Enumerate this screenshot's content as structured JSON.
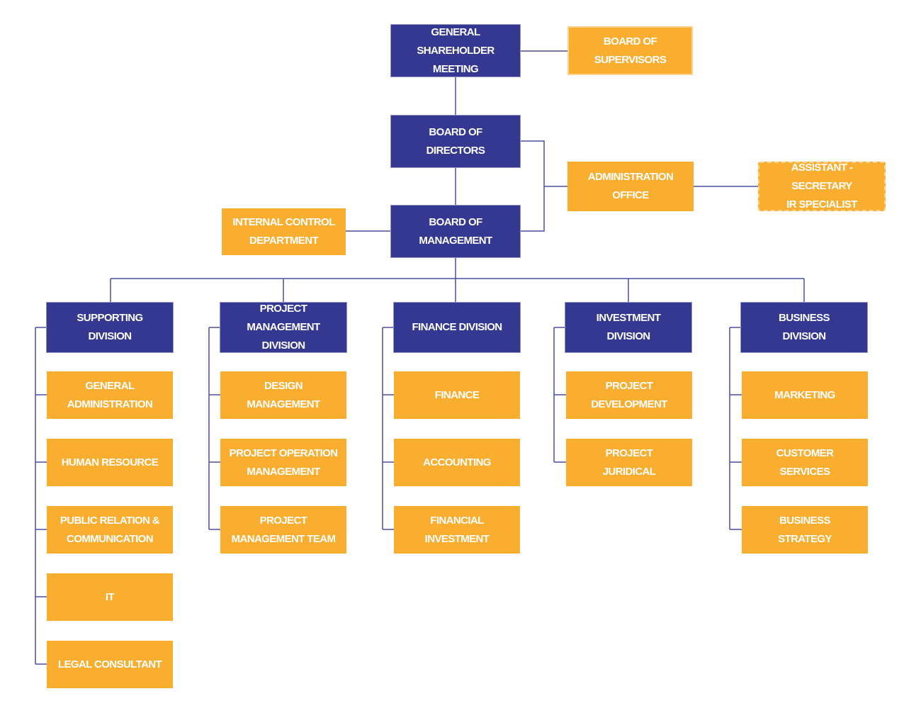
{
  "colors": {
    "primary": "#353891",
    "secondary": "#f9ae30",
    "connector": "#4b4da2"
  },
  "top": {
    "general_shareholder_meeting": "GENERAL\nSHAREHOLDER MEETING",
    "board_of_supervisors": "BOARD OF\nSUPERVISORS",
    "board_of_directors": "BOARD OF\nDIRECTORS",
    "administration_office": "ADMINISTRATION\nOFFICE",
    "assistant_secretary": "ASSISTANT - SECRETARY\nIR SPECIALIST",
    "board_of_management": "BOARD OF\nMANAGEMENT",
    "internal_control": "INTERNAL CONTROL\nDEPARTMENT"
  },
  "divisions": [
    {
      "label": "SUPPORTING\nDIVISION",
      "units": [
        "GENERAL\nADMINISTRATION",
        "HUMAN RESOURCE",
        "PUBLIC RELATION &\nCOMMUNICATION",
        "IT",
        "LEGAL CONSULTANT"
      ]
    },
    {
      "label": "PROJECT MANAGEMENT\nDIVISION",
      "units": [
        "DESIGN\nMANAGEMENT",
        "PROJECT OPERATION\nMANAGEMENT",
        "PROJECT\nMANAGEMENT TEAM"
      ]
    },
    {
      "label": "FINANCE DIVISION",
      "units": [
        "FINANCE",
        "ACCOUNTING",
        "FINANCIAL\nINVESTMENT"
      ]
    },
    {
      "label": "INVESTMENT\nDIVISION",
      "units": [
        "PROJECT\nDEVELOPMENT",
        "PROJECT\nJURIDICAL"
      ]
    },
    {
      "label": "BUSINESS\nDIVISION",
      "units": [
        "MARKETING",
        "CUSTOMER\nSERVICES",
        "BUSINESS\nSTRATEGY"
      ]
    }
  ]
}
